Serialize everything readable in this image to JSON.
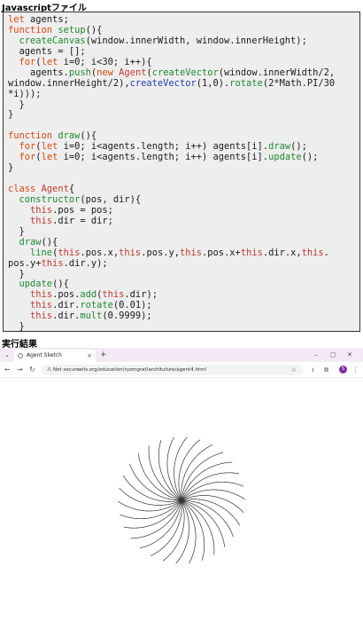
{
  "labels": {
    "code_section": "Javascriptファイル",
    "result_section": "実行結果"
  },
  "code_lines": [
    [
      {
        "t": "let",
        "c": "kw"
      },
      {
        "t": " agents;",
        "c": ""
      }
    ],
    [
      {
        "t": "function",
        "c": "kw"
      },
      {
        "t": " ",
        "c": ""
      },
      {
        "t": "setup",
        "c": "fn"
      },
      {
        "t": "(){",
        "c": ""
      }
    ],
    [
      {
        "t": "  ",
        "c": ""
      },
      {
        "t": "createCanvas",
        "c": "fn"
      },
      {
        "t": "(window.innerWidth, window.innerHeight);",
        "c": ""
      }
    ],
    [
      {
        "t": "  agents = [];",
        "c": ""
      }
    ],
    [
      {
        "t": "  ",
        "c": ""
      },
      {
        "t": "for",
        "c": "kw"
      },
      {
        "t": "(",
        "c": ""
      },
      {
        "t": "let",
        "c": "kw"
      },
      {
        "t": " i=0; i<30; i++){",
        "c": ""
      }
    ],
    [
      {
        "t": "    agents.",
        "c": ""
      },
      {
        "t": "push",
        "c": "fn"
      },
      {
        "t": "(",
        "c": ""
      },
      {
        "t": "new",
        "c": "kw"
      },
      {
        "t": " ",
        "c": ""
      },
      {
        "t": "Agent",
        "c": "th"
      },
      {
        "t": "(",
        "c": ""
      },
      {
        "t": "createVector",
        "c": "fn"
      },
      {
        "t": "(window.innerWidth/2,",
        "c": ""
      }
    ],
    [
      {
        "t": "window.innerHeight/2),",
        "c": ""
      },
      {
        "t": "createVector",
        "c": "bl"
      },
      {
        "t": "(1,0).",
        "c": ""
      },
      {
        "t": "rotate",
        "c": "fn"
      },
      {
        "t": "(2*Math.PI/30",
        "c": ""
      }
    ],
    [
      {
        "t": "*i)));",
        "c": ""
      }
    ],
    [
      {
        "t": "  }",
        "c": ""
      }
    ],
    [
      {
        "t": "}",
        "c": ""
      }
    ],
    [
      {
        "t": "",
        "c": ""
      }
    ],
    [
      {
        "t": "function",
        "c": "kw"
      },
      {
        "t": " ",
        "c": ""
      },
      {
        "t": "draw",
        "c": "fn"
      },
      {
        "t": "(){",
        "c": ""
      }
    ],
    [
      {
        "t": "  ",
        "c": ""
      },
      {
        "t": "for",
        "c": "kw"
      },
      {
        "t": "(",
        "c": ""
      },
      {
        "t": "let",
        "c": "kw"
      },
      {
        "t": " i=0; i<agents.length; i++) agents[i].",
        "c": ""
      },
      {
        "t": "draw",
        "c": "fn"
      },
      {
        "t": "();",
        "c": ""
      }
    ],
    [
      {
        "t": "  ",
        "c": ""
      },
      {
        "t": "for",
        "c": "kw"
      },
      {
        "t": "(",
        "c": ""
      },
      {
        "t": "let",
        "c": "kw"
      },
      {
        "t": " i=0; i<agents.length; i++) agents[i].",
        "c": ""
      },
      {
        "t": "update",
        "c": "fn"
      },
      {
        "t": "();",
        "c": ""
      }
    ],
    [
      {
        "t": "}",
        "c": ""
      }
    ],
    [
      {
        "t": "",
        "c": ""
      }
    ],
    [
      {
        "t": "class",
        "c": "kw"
      },
      {
        "t": " ",
        "c": ""
      },
      {
        "t": "Agent",
        "c": "th"
      },
      {
        "t": "{",
        "c": ""
      }
    ],
    [
      {
        "t": "  ",
        "c": ""
      },
      {
        "t": "constructor",
        "c": "fn"
      },
      {
        "t": "(pos, dir){",
        "c": ""
      }
    ],
    [
      {
        "t": "    ",
        "c": ""
      },
      {
        "t": "this",
        "c": "th"
      },
      {
        "t": ".pos = pos;",
        "c": ""
      }
    ],
    [
      {
        "t": "    ",
        "c": ""
      },
      {
        "t": "this",
        "c": "th"
      },
      {
        "t": ".dir = dir;",
        "c": ""
      }
    ],
    [
      {
        "t": "  }",
        "c": ""
      }
    ],
    [
      {
        "t": "  ",
        "c": ""
      },
      {
        "t": "draw",
        "c": "fn"
      },
      {
        "t": "(){",
        "c": ""
      }
    ],
    [
      {
        "t": "    ",
        "c": ""
      },
      {
        "t": "line",
        "c": "fn"
      },
      {
        "t": "(",
        "c": ""
      },
      {
        "t": "this",
        "c": "th"
      },
      {
        "t": ".pos.x,",
        "c": ""
      },
      {
        "t": "this",
        "c": "th"
      },
      {
        "t": ".pos.y,",
        "c": ""
      },
      {
        "t": "this",
        "c": "th"
      },
      {
        "t": ".pos.x+",
        "c": ""
      },
      {
        "t": "this",
        "c": "th"
      },
      {
        "t": ".dir.x,",
        "c": ""
      },
      {
        "t": "this",
        "c": "th"
      },
      {
        "t": ".",
        "c": ""
      }
    ],
    [
      {
        "t": "pos.y+",
        "c": ""
      },
      {
        "t": "this",
        "c": "th"
      },
      {
        "t": ".dir.y);",
        "c": ""
      }
    ],
    [
      {
        "t": "  }",
        "c": ""
      }
    ],
    [
      {
        "t": "  ",
        "c": ""
      },
      {
        "t": "update",
        "c": "fn"
      },
      {
        "t": "(){",
        "c": ""
      }
    ],
    [
      {
        "t": "    ",
        "c": ""
      },
      {
        "t": "this",
        "c": "th"
      },
      {
        "t": ".pos.",
        "c": ""
      },
      {
        "t": "add",
        "c": "fn"
      },
      {
        "t": "(",
        "c": ""
      },
      {
        "t": "this",
        "c": "th"
      },
      {
        "t": ".dir);",
        "c": ""
      }
    ],
    [
      {
        "t": "    ",
        "c": ""
      },
      {
        "t": "this",
        "c": "th"
      },
      {
        "t": ".dir.",
        "c": ""
      },
      {
        "t": "rotate",
        "c": "fn"
      },
      {
        "t": "(0.01);",
        "c": ""
      }
    ],
    [
      {
        "t": "    ",
        "c": ""
      },
      {
        "t": "this",
        "c": "th"
      },
      {
        "t": ".dir.",
        "c": ""
      },
      {
        "t": "mult",
        "c": "fn"
      },
      {
        "t": "(0.9999);",
        "c": ""
      }
    ],
    [
      {
        "t": "  }",
        "c": ""
      }
    ],
    [
      {
        "t": "}",
        "c": ""
      }
    ]
  ],
  "browser": {
    "tab_title": "Agent Sketch",
    "tab_close": "×",
    "new_tab": "+",
    "minimize": "–",
    "maximize": "▢",
    "close": "✕",
    "not_secure": "Not secure",
    "url": "atlv.org/education/ryzmgraf/architufure/agent4.html",
    "profile_initial": "S"
  },
  "sketch": {
    "agent_count": 30,
    "stroke_color": "#333333",
    "background": "#ffffff"
  }
}
